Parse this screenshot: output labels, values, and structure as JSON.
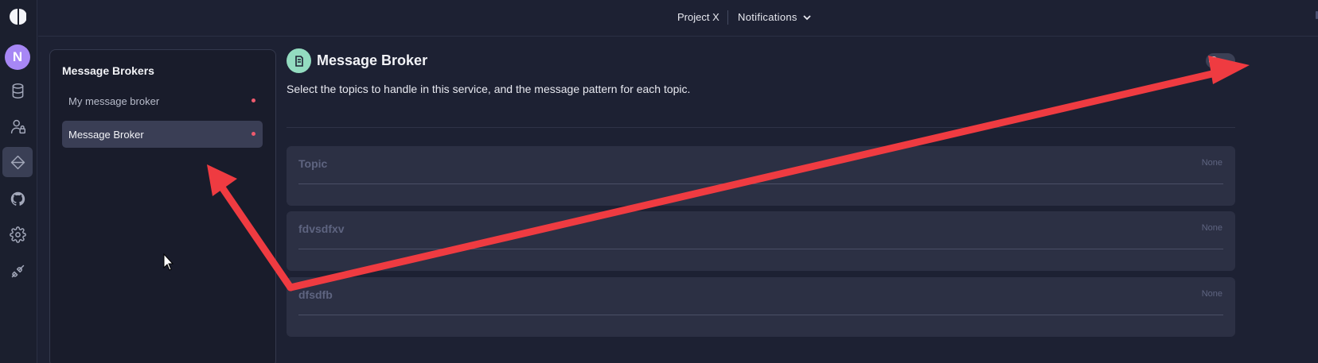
{
  "topbar": {
    "project": "Project X",
    "notifications": "Notifications"
  },
  "rail": {
    "avatar_initial": "N",
    "icons": [
      "database-icon",
      "user-lock-icon",
      "diamond-nav-icon",
      "github-icon",
      "gear-icon",
      "plug-icon"
    ]
  },
  "panel": {
    "title": "Message Brokers",
    "items": [
      {
        "label": "My message broker",
        "selected": false
      },
      {
        "label": "Message Broker",
        "selected": true
      }
    ]
  },
  "main": {
    "title": "Message Broker",
    "description": "Select the topics to handle in this service, and the message pattern for each topic.",
    "toggle_on": false,
    "topics": [
      {
        "name": "Topic",
        "pattern": "None"
      },
      {
        "name": "fdvsdfxv",
        "pattern": "None"
      },
      {
        "name": "dfsdfb",
        "pattern": "None"
      }
    ]
  },
  "colors": {
    "background": "#1d2133",
    "accent_avatar": "#a787f5",
    "accent_icon": "#93dcc0",
    "dot": "#ee5a6e",
    "annotation_arrow": "#ef3b41"
  }
}
